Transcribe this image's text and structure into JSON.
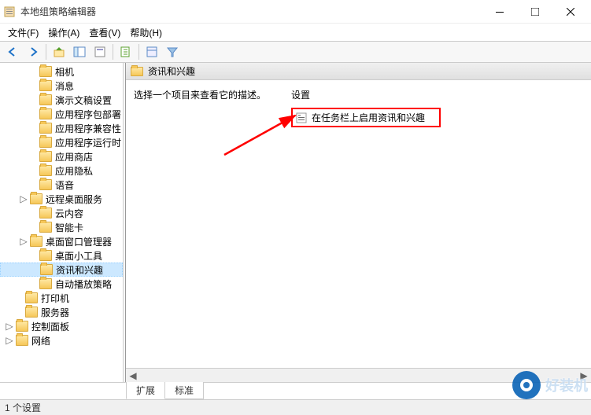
{
  "window": {
    "title": "本地组策略编辑器"
  },
  "menu": {
    "file": "文件(F)",
    "action": "操作(A)",
    "view": "查看(V)",
    "help": "帮助(H)"
  },
  "tree": {
    "items": [
      {
        "label": "相机",
        "indent": 36
      },
      {
        "label": "消息",
        "indent": 36
      },
      {
        "label": "演示文稿设置",
        "indent": 36
      },
      {
        "label": "应用程序包部署",
        "indent": 36
      },
      {
        "label": "应用程序兼容性",
        "indent": 36
      },
      {
        "label": "应用程序运行时",
        "indent": 36
      },
      {
        "label": "应用商店",
        "indent": 36
      },
      {
        "label": "应用隐私",
        "indent": 36
      },
      {
        "label": "语音",
        "indent": 36
      },
      {
        "label": "远程桌面服务",
        "indent": 24,
        "expander": "▷"
      },
      {
        "label": "云内容",
        "indent": 36
      },
      {
        "label": "智能卡",
        "indent": 36
      },
      {
        "label": "桌面窗口管理器",
        "indent": 24,
        "expander": "▷"
      },
      {
        "label": "桌面小工具",
        "indent": 36
      },
      {
        "label": "资讯和兴趣",
        "indent": 36,
        "selected": true
      },
      {
        "label": "自动播放策略",
        "indent": 36
      },
      {
        "label": "打印机",
        "indent": 18
      },
      {
        "label": "服务器",
        "indent": 18
      },
      {
        "label": "控制面板",
        "indent": 6,
        "expander": "▷"
      },
      {
        "label": "网络",
        "indent": 6,
        "expander": "▷"
      }
    ]
  },
  "content": {
    "header": "资讯和兴趣",
    "description": "选择一个项目来查看它的描述。",
    "settings_header": "设置",
    "setting_item": "在任务栏上启用资讯和兴趣"
  },
  "tabs": {
    "extended": "扩展",
    "standard": "标准"
  },
  "statusbar": {
    "text": "1 个设置"
  },
  "watermark": {
    "text": "好装机"
  }
}
